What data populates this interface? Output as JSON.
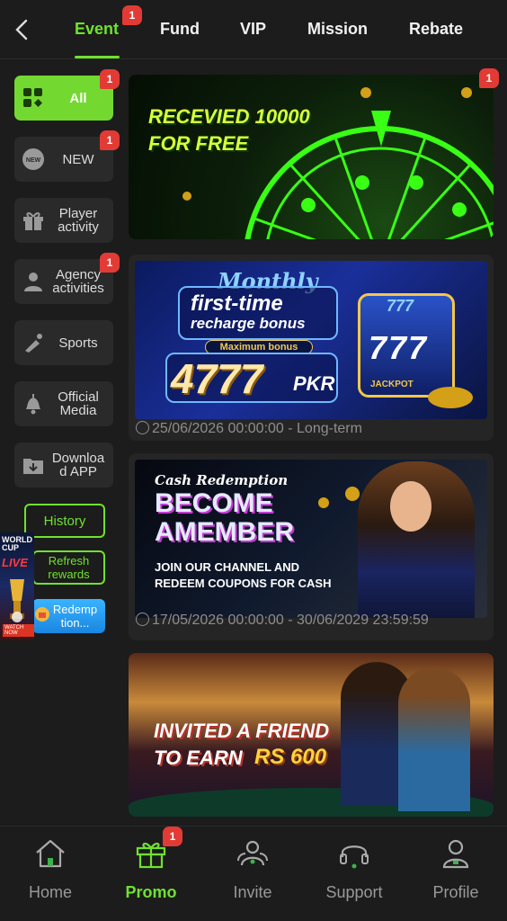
{
  "tabs": [
    {
      "label": "Event",
      "active": true,
      "badge": "1"
    },
    {
      "label": "Fund"
    },
    {
      "label": "VIP"
    },
    {
      "label": "Mission"
    },
    {
      "label": "Rebate"
    }
  ],
  "sidebar": {
    "items": [
      {
        "label": "All",
        "badge": "1",
        "active": true
      },
      {
        "label": "NEW",
        "badge": "1",
        "icon_text": "NEW"
      },
      {
        "label": "Player activity"
      },
      {
        "label": "Agency activities",
        "badge": "1"
      },
      {
        "label": "Sports"
      },
      {
        "label": "Official Media"
      },
      {
        "label": "Downloa d APP"
      }
    ],
    "history": "History",
    "refresh": "Refresh rewards",
    "redemption": "Redemp tion..."
  },
  "floating_ad": {
    "line1": "WORLD CUP",
    "line2": "LIVE",
    "line3": "WATCH NOW"
  },
  "cards": [
    {
      "badge": "1",
      "banner": {
        "title1": "RECEVIED 10000",
        "title2": "FOR FREE"
      }
    },
    {
      "date": "25/06/2026 00:00:00 - Long-term",
      "banner": {
        "script": "Monthly",
        "title1": "first-time",
        "title2": "recharge bonus",
        "sub": "Maximum bonus",
        "amount": "4777",
        "currency": "PKR",
        "reels": "777",
        "jackpot": "JACKPOT"
      }
    },
    {
      "date": "17/05/2026 00:00:00 - 30/06/2029 23:59:59",
      "banner": {
        "script": "Cash Redemption",
        "title1": "BECOME",
        "title2": "AMEMBER",
        "line1": "JOIN OUR CHANNEL AND",
        "line2": "REDEEM COUPONS FOR CASH"
      }
    },
    {
      "banner": {
        "title1": "INVITED A FRIEND",
        "title2": "TO EARN",
        "amount": "RS 600"
      }
    }
  ],
  "bottom_nav": [
    {
      "label": "Home",
      "icon": "home-icon"
    },
    {
      "label": "Promo",
      "icon": "gift-icon",
      "active": true,
      "badge": "1"
    },
    {
      "label": "Invite",
      "icon": "users-icon"
    },
    {
      "label": "Support",
      "icon": "headset-icon"
    },
    {
      "label": "Profile",
      "icon": "profile-icon"
    }
  ],
  "colors": {
    "accent": "#6fe22d",
    "badge": "#e23b35",
    "background": "#1c1c1c",
    "card": "#252525"
  }
}
